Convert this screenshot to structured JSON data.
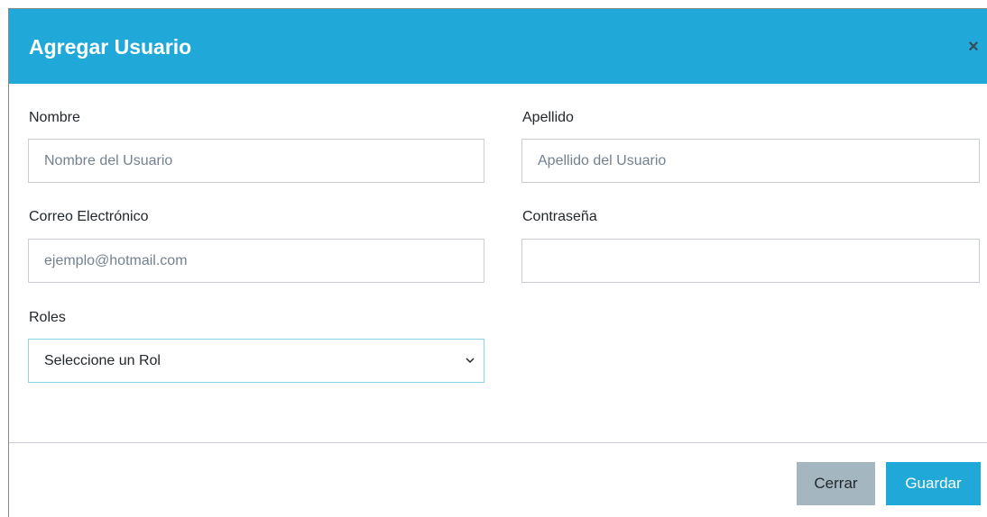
{
  "modal": {
    "title": "Agregar Usuario",
    "close_symbol": "×"
  },
  "form": {
    "first_name": {
      "label": "Nombre",
      "placeholder": "Nombre del Usuario",
      "value": ""
    },
    "last_name": {
      "label": "Apellido",
      "placeholder": "Apellido del Usuario",
      "value": ""
    },
    "email": {
      "label": "Correo Electrónico",
      "placeholder": "ejemplo@hotmail.com",
      "value": ""
    },
    "password": {
      "label": "Contraseña",
      "placeholder": "",
      "value": ""
    },
    "roles": {
      "label": "Roles",
      "selected": "Seleccione un Rol"
    }
  },
  "footer": {
    "close_label": "Cerrar",
    "save_label": "Guardar"
  },
  "colors": {
    "header": "#20a8d8",
    "save_button": "#20a8d8",
    "close_button": "#a4b7c1"
  },
  "icons": {
    "close": "close-icon",
    "select_arrow": "chevron-down-icon"
  }
}
